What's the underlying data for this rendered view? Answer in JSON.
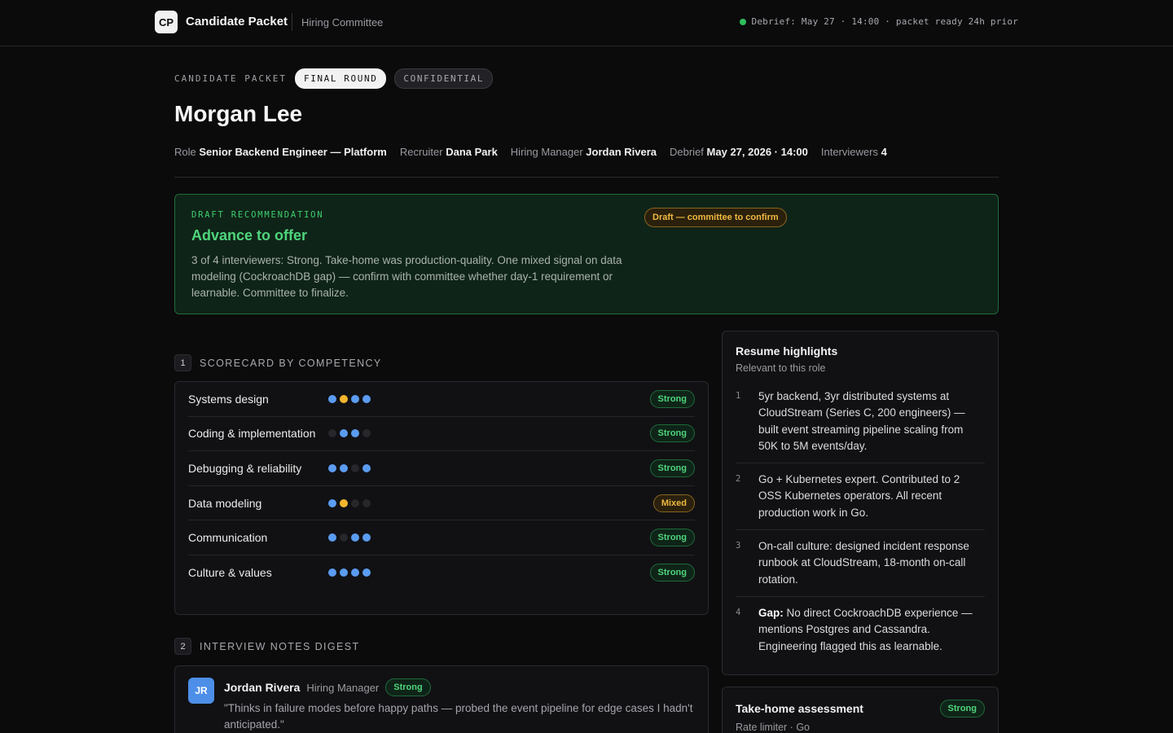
{
  "topbar": {
    "logo": "CP",
    "title": "Candidate Packet",
    "subtitle": "Hiring Committee",
    "status": "Debrief: May 27 · 14:00 · packet ready 24h prior",
    "status_color": "#2fbf5b"
  },
  "header": {
    "eyebrow": "CANDIDATE PACKET",
    "tag_round": "FINAL ROUND",
    "tag_conf": "CONFIDENTIAL",
    "name": "Morgan Lee",
    "meta": {
      "role_label": "Role",
      "role": "Senior Backend Engineer — Platform",
      "recruiter_label": "Recruiter",
      "recruiter": "Dana Park",
      "hm_label": "Hiring Manager",
      "hm": "Jordan Rivera",
      "debrief_label": "Debrief",
      "debrief": "May 27, 2026 · 14:00",
      "interviewers_label": "Interviewers",
      "interviewers": "4"
    }
  },
  "recommendation": {
    "eyebrow": "DRAFT RECOMMENDATION",
    "title": "Advance to offer",
    "body": "3 of 4 interviewers: Strong. Take-home was production-quality. One mixed signal on data modeling (CockroachDB gap) — confirm with committee whether day-1 requirement or learnable. Committee to finalize.",
    "badge": "Draft — committee to confirm"
  },
  "scorecard": {
    "num": "1",
    "title": "SCORECARD BY COMPETENCY",
    "rows": [
      {
        "label": "Systems design",
        "dots": [
          "blue",
          "yellow",
          "blue",
          "blue"
        ],
        "rating": "Strong"
      },
      {
        "label": "Coding & implementation",
        "dots": [
          "empty",
          "blue",
          "blue",
          "empty"
        ],
        "rating": "Strong"
      },
      {
        "label": "Debugging & reliability",
        "dots": [
          "blue",
          "blue",
          "empty",
          "blue"
        ],
        "rating": "Strong"
      },
      {
        "label": "Data modeling",
        "dots": [
          "blue",
          "yellow",
          "empty",
          "empty"
        ],
        "rating": "Mixed"
      },
      {
        "label": "Communication",
        "dots": [
          "blue",
          "empty",
          "blue",
          "blue"
        ],
        "rating": "Strong"
      },
      {
        "label": "Culture & values",
        "dots": [
          "blue",
          "blue",
          "blue",
          "blue"
        ],
        "rating": "Strong"
      }
    ]
  },
  "notes": {
    "num": "2",
    "title": "INTERVIEW NOTES DIGEST",
    "items": [
      {
        "initials": "JR",
        "name": "Jordan Rivera",
        "role": "Hiring Manager",
        "rating": "Strong",
        "quote": "\"Thinks in failure modes before happy paths — probed the event pipeline for edge cases I hadn't anticipated.\""
      }
    ]
  },
  "resume": {
    "title": "Resume highlights",
    "subtitle": "Relevant to this role",
    "items": [
      {
        "num": "1",
        "bold": "",
        "text": "5yr backend, 3yr distributed systems at CloudStream (Series C, 200 engineers) — built event streaming pipeline scaling from 50K to 5M events/day."
      },
      {
        "num": "2",
        "bold": "",
        "text": "Go + Kubernetes expert. Contributed to 2 OSS Kubernetes operators. All recent production work in Go."
      },
      {
        "num": "3",
        "bold": "",
        "text": "On-call culture: designed incident response runbook at CloudStream, 18-month on-call rotation."
      },
      {
        "num": "4",
        "bold": "Gap:",
        "text": " No direct CockroachDB experience — mentions Postgres and Cassandra. Engineering flagged this as learnable."
      }
    ]
  },
  "takehome": {
    "title": "Take-home assessment",
    "subtitle": "Rate limiter · Go",
    "rating": "Strong"
  }
}
